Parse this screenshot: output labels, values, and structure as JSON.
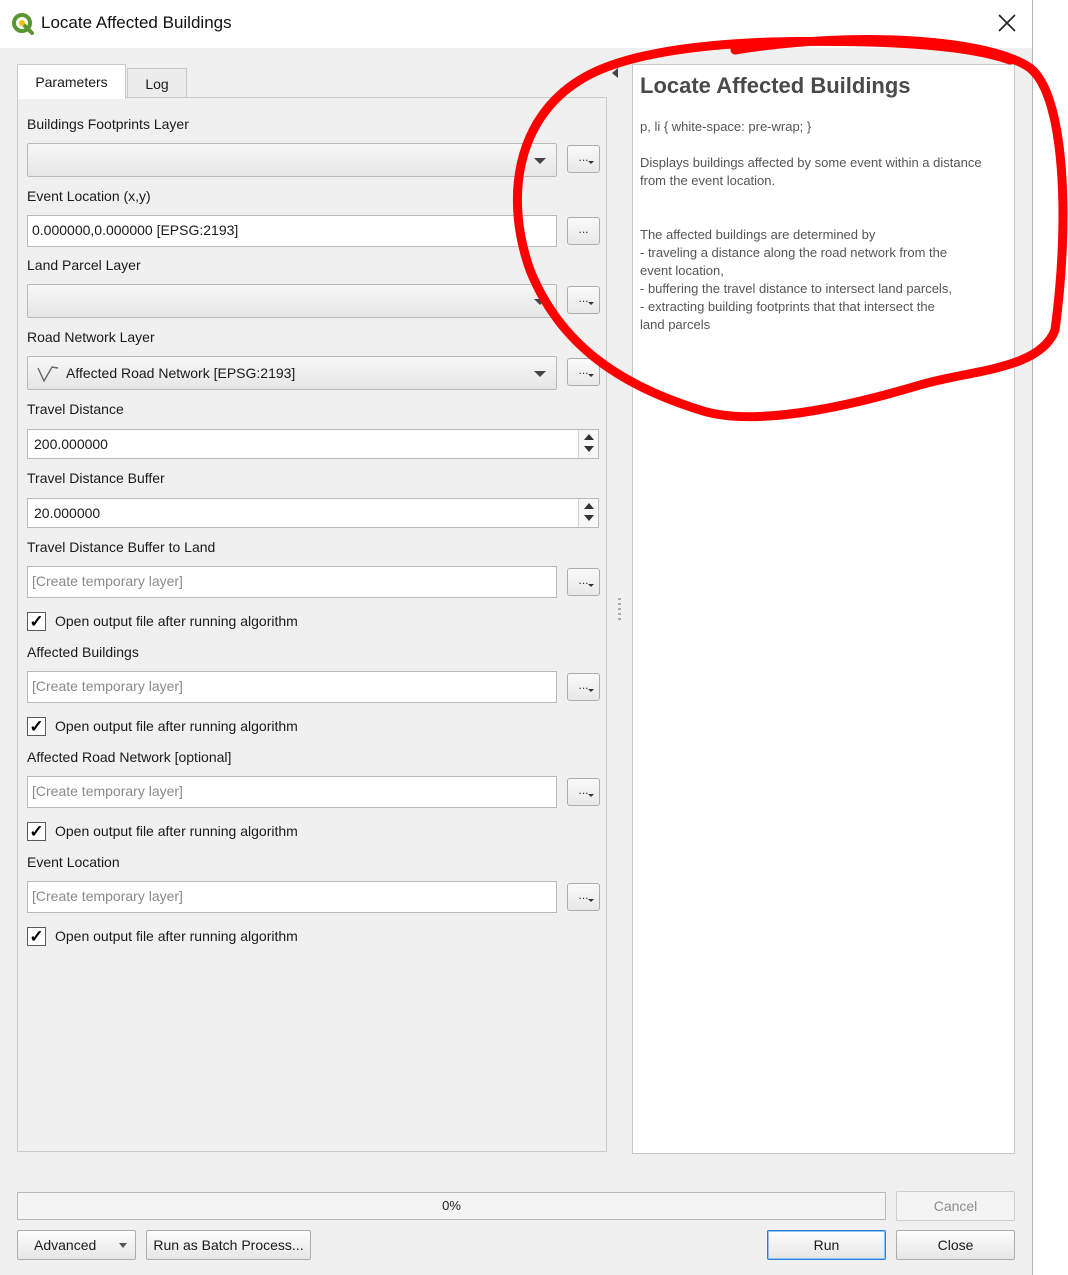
{
  "window": {
    "title": "Locate Affected Buildings"
  },
  "tabs": [
    {
      "label": "Parameters"
    },
    {
      "label": "Log"
    }
  ],
  "params": {
    "buildings_footprints": {
      "label": "Buildings Footprints Layer",
      "value": ""
    },
    "event_location": {
      "label": "Event Location (x,y)",
      "value": "0.000000,0.000000 [EPSG:2193]"
    },
    "land_parcel": {
      "label": "Land Parcel Layer",
      "value": ""
    },
    "road_network": {
      "label": "Road Network Layer",
      "value": "Affected Road Network [EPSG:2193]"
    },
    "travel_distance": {
      "label": "Travel Distance",
      "value": "200.000000"
    },
    "travel_distance_buffer": {
      "label": "Travel Distance Buffer",
      "value": "20.000000"
    },
    "buffer_to_land": {
      "label": "Travel Distance Buffer to Land",
      "placeholder": "[Create temporary layer]",
      "open_output": "Open output file after running algorithm",
      "checked": true
    },
    "affected_buildings": {
      "label": "Affected Buildings",
      "placeholder": "[Create temporary layer]",
      "open_output": "Open output file after running algorithm",
      "checked": true
    },
    "affected_road_network": {
      "label": "Affected Road Network [optional]",
      "placeholder": "[Create temporary layer]",
      "open_output": "Open output file after running algorithm",
      "checked": true
    },
    "event_location_out": {
      "label": "Event Location",
      "placeholder": "[Create temporary layer]",
      "open_output": "Open output file after running algorithm",
      "checked": true
    },
    "dots_label": "..."
  },
  "help": {
    "title": "Locate Affected Buildings",
    "css_line": "p, li { white-space: pre-wrap; }",
    "description": "Displays buildings affected by some event within a distance from the event location.",
    "detail_lines": [
      "The affected buildings are determined by",
      "- traveling a distance along the road network from the",
      "event location,",
      "- buffering the travel distance to intersect land parcels,",
      "- extracting building footprints that that intersect the",
      "land parcels"
    ]
  },
  "footer": {
    "progress_text": "0%",
    "progress_value": 0,
    "cancel": "Cancel",
    "advanced": "Advanced",
    "batch": "Run as Batch Process...",
    "run": "Run",
    "close": "Close"
  },
  "checkmark": "✓",
  "colors": {
    "annotation": "#ff0000",
    "qgis_green": "#589632",
    "default_button_border": "#2c7fd6"
  }
}
